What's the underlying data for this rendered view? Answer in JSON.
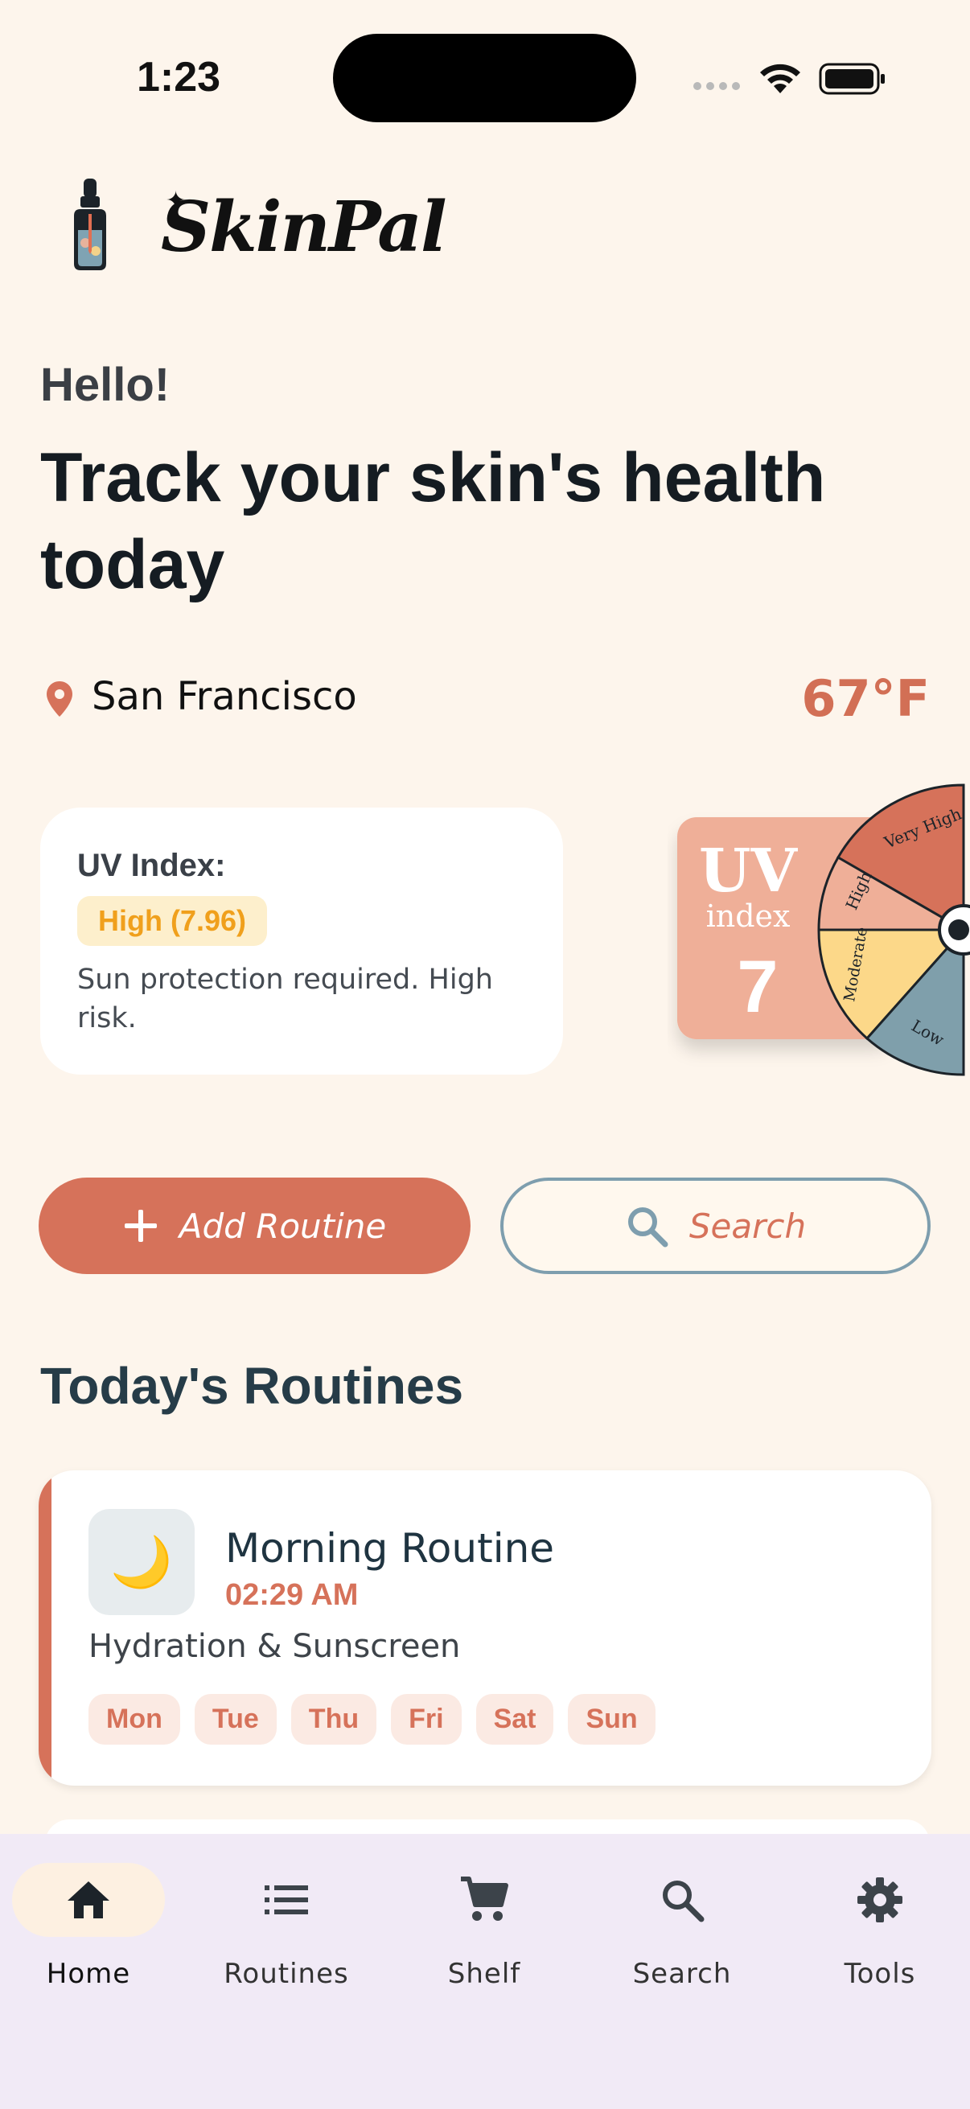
{
  "status_bar": {
    "time": "1:23"
  },
  "app": {
    "name": "SkinPal"
  },
  "greeting": "Hello!",
  "headline": "Track your skin's health today",
  "location": {
    "city": "San Francisco",
    "temperature": "67°F"
  },
  "uv": {
    "label": "UV Index:",
    "level": "High (7.96)",
    "description": "Sun protection required. High risk.",
    "graphic": {
      "title_top": "UV",
      "title_bottom": "index",
      "value": "7",
      "segments": [
        "Very High",
        "High",
        "Moderate",
        "Low"
      ]
    }
  },
  "actions": {
    "add_routine": "Add Routine",
    "search": "Search"
  },
  "routines": {
    "section_title": "Today's Routines",
    "items": [
      {
        "icon": "🌙",
        "title": "Morning Routine",
        "time": "02:29 AM",
        "subtitle": "Hydration & Sunscreen",
        "days": [
          "Mon",
          "Tue",
          "Thu",
          "Fri",
          "Sat",
          "Sun"
        ]
      }
    ]
  },
  "nav": {
    "items": [
      {
        "label": "Home",
        "icon": "home-icon"
      },
      {
        "label": "Routines",
        "icon": "list-icon"
      },
      {
        "label": "Shelf",
        "icon": "cart-icon"
      },
      {
        "label": "Search",
        "icon": "search-icon"
      },
      {
        "label": "Tools",
        "icon": "gear-icon"
      }
    ]
  },
  "colors": {
    "background": "#fdf5ec",
    "accent": "#d6725a",
    "uv_high": "#f0a01c",
    "nav_bg": "#f1eaf6"
  }
}
